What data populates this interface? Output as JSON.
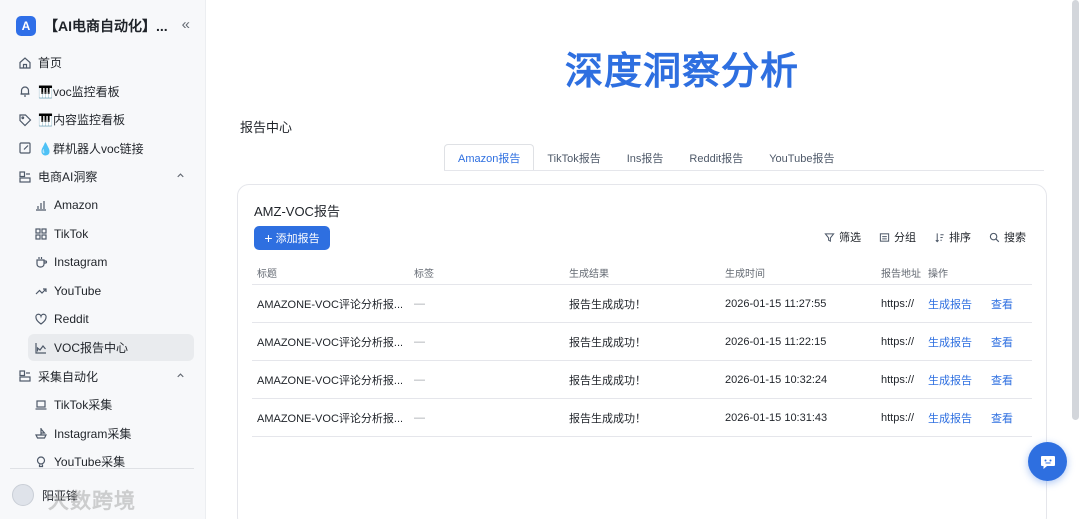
{
  "app": {
    "logo_glyph": "A",
    "title": "【AI电商自动化】...",
    "collapse_glyph": "«"
  },
  "sidebar": {
    "items": [
      {
        "label": "首页",
        "icon": "home-icon"
      },
      {
        "label": "🎹voc监控看板",
        "icon": "bell-icon"
      },
      {
        "label": "🎹内容监控看板",
        "icon": "tag-icon"
      },
      {
        "label": "💧群机器人voc链接",
        "icon": "edit-icon"
      },
      {
        "label": "电商AI洞察",
        "icon": "folder-icon",
        "expanded": true
      },
      {
        "label": "Amazon",
        "icon": "bar-chart-icon"
      },
      {
        "label": "TikTok",
        "icon": "grid-icon"
      },
      {
        "label": "Instagram",
        "icon": "cup-icon"
      },
      {
        "label": "YouTube",
        "icon": "trend-icon"
      },
      {
        "label": "Reddit",
        "icon": "heart-icon"
      },
      {
        "label": "VOC报告中心",
        "icon": "area-chart-icon",
        "active": true
      },
      {
        "label": "采集自动化",
        "icon": "folder-icon",
        "expanded": true
      },
      {
        "label": "TikTok采集",
        "icon": "laptop-icon"
      },
      {
        "label": "Instagram采集",
        "icon": "boat-icon"
      },
      {
        "label": "YouTube采集",
        "icon": "bulb-icon"
      }
    ],
    "user_name": "阳亚锋",
    "watermark": "大数跨境"
  },
  "main": {
    "title": "深度洞察分析",
    "section_title": "报告中心",
    "tabs": [
      "Amazon报告",
      "TikTok报告",
      "Ins报告",
      "Reddit报告",
      "YouTube报告"
    ],
    "active_tab": "Amazon报告"
  },
  "card": {
    "title": "AMZ-VOC报告",
    "add_button": "添加报告",
    "toolbar": {
      "filter": "筛选",
      "group": "分组",
      "sort": "排序",
      "search": "搜索"
    },
    "columns": [
      "标题",
      "标签",
      "生成结果",
      "生成时间",
      "报告地址",
      "操作"
    ],
    "rows": [
      {
        "title": "AMAZONE-VOC评论分析报...",
        "tag": "—",
        "result": "报告生成成功！",
        "time": "2026-01-15 11:27:55",
        "url": "https://",
        "action1": "生成报告",
        "action2": "查看"
      },
      {
        "title": "AMAZONE-VOC评论分析报...",
        "tag": "—",
        "result": "报告生成成功！",
        "time": "2026-01-15 11:22:15",
        "url": "https://",
        "action1": "生成报告",
        "action2": "查看"
      },
      {
        "title": "AMAZONE-VOC评论分析报...",
        "tag": "—",
        "result": "报告生成成功！",
        "time": "2026-01-15 10:32:24",
        "url": "https://",
        "action1": "生成报告",
        "action2": "查看"
      },
      {
        "title": "AMAZONE-VOC评论分析报...",
        "tag": "—",
        "result": "报告生成成功！",
        "time": "2026-01-15 10:31:43",
        "url": "https://",
        "action1": "生成报告",
        "action2": "查看"
      }
    ]
  },
  "colors": {
    "accent": "#2e6fe0",
    "sidebar_bg": "#f7f8fa",
    "active_item_bg": "#e9ebee"
  }
}
